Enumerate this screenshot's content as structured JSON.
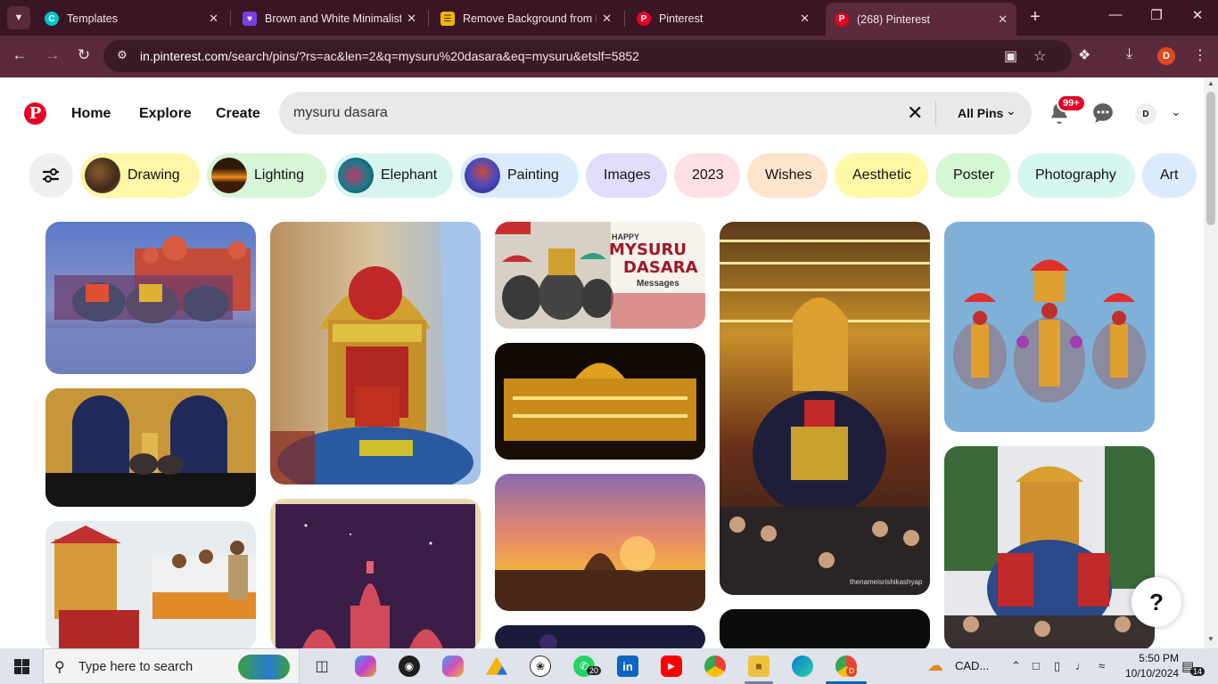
{
  "browser": {
    "tabs": [
      {
        "label": "Templates",
        "icon": "canva-icon",
        "color": "#00c4cc"
      },
      {
        "label": "Brown and White Minimalist",
        "icon": "heart-app-icon",
        "color": "#7b3fe4"
      },
      {
        "label": "Remove Background from Im",
        "icon": "layers-icon",
        "color": "#f5b400"
      },
      {
        "label": "Pinterest",
        "icon": "pinterest-icon",
        "color": "#e60023"
      },
      {
        "label": "(268) Pinterest",
        "icon": "pinterest-icon",
        "color": "#e60023"
      }
    ],
    "url_host": "in.pinterest.com",
    "url_path": "/search/pins/?rs=ac&len=2&q=mysuru%20dasara&eq=mysuru&etslf=5852",
    "profile_initial": "D"
  },
  "pinterest": {
    "nav": {
      "home": "Home",
      "explore": "Explore",
      "create": "Create"
    },
    "search_value": "mysuru dasara",
    "scope": "All Pins",
    "notification_badge": "99+",
    "avatar_initial": "D",
    "chips": [
      {
        "label": "Drawing",
        "bg": "#fef7a7"
      },
      {
        "label": "Lighting",
        "bg": "#d6f6d7"
      },
      {
        "label": "Elephant",
        "bg": "#d7f5f0"
      },
      {
        "label": "Painting",
        "bg": "#dcebfb"
      },
      {
        "label": "Images",
        "bg": "#e1defd"
      },
      {
        "label": "2023",
        "bg": "#fddfe5"
      },
      {
        "label": "Wishes",
        "bg": "#fde4cc"
      },
      {
        "label": "Aesthetic",
        "bg": "#fef9a6"
      },
      {
        "label": "Poster",
        "bg": "#d4f7d4"
      },
      {
        "label": "Photography",
        "bg": "#d6f6f2"
      },
      {
        "label": "Art",
        "bg": "#dcebfb"
      }
    ],
    "pin_texts": {
      "happy": "HAPPY",
      "mysuru": "MYSURU",
      "dasara": "DASARA",
      "messages": "Messages",
      "watermark": "thenameisrishikashyap"
    },
    "help": "?"
  },
  "taskbar": {
    "search_placeholder": "Type here to search",
    "whatsapp_count": "20",
    "weather": "CAD...",
    "time": "5:50 PM",
    "date": "10/10/2024",
    "notifications": "14"
  }
}
